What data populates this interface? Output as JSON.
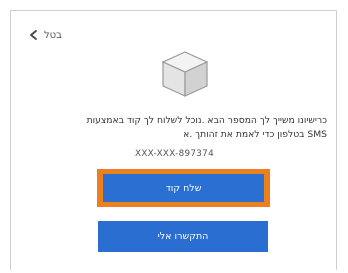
{
  "back": {
    "label": "בטל",
    "icon": "chevron-left-icon"
  },
  "illustration": {
    "icon": "cube-icon"
  },
  "message": {
    "line1": "כרישיונו משייך לך המספר הבא .נוכל לשלוח לך קוד באמצעות",
    "line2": "SMS בטלפון כדי לאמת את זהותך .א"
  },
  "phone_masked": "XXX-XXX-897374",
  "buttons": {
    "send_code": "שלח קוד",
    "call_me": "התקשרו אלי"
  },
  "colors": {
    "primary_button": "#2a6fd2",
    "highlight_border": "#ee7f1e"
  }
}
